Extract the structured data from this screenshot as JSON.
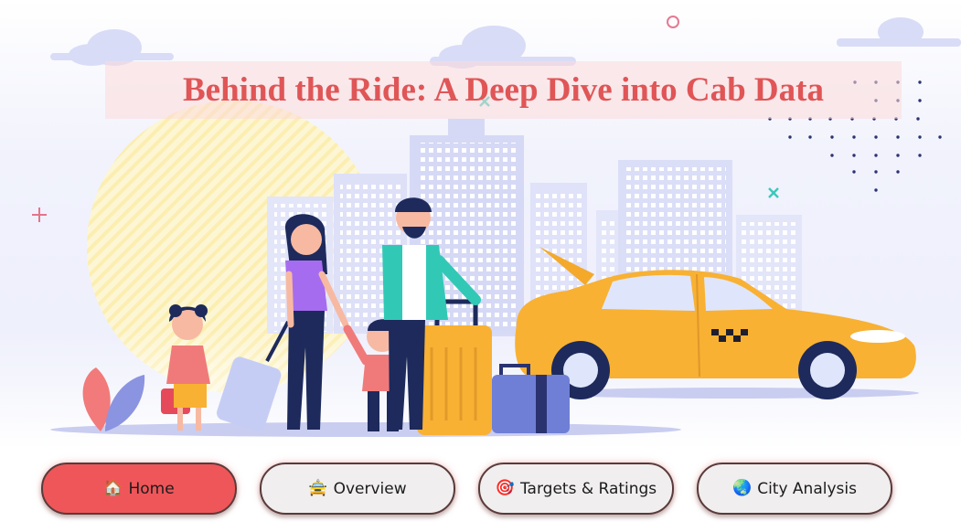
{
  "page": {
    "title": "Behind the Ride: A Deep Dive into Cab Data"
  },
  "nav": {
    "active": "home",
    "buttons": [
      {
        "id": "home",
        "label": "Home",
        "icon": "house-icon",
        "glyph": "🏠"
      },
      {
        "id": "overview",
        "label": "Overview",
        "icon": "taxi-icon",
        "glyph": "🚖"
      },
      {
        "id": "targets",
        "label": "Targets & Ratings",
        "icon": "target-icon",
        "glyph": "🎯"
      },
      {
        "id": "city",
        "label": "City Analysis",
        "icon": "globe-icon",
        "glyph": "🌏"
      }
    ]
  },
  "colors": {
    "accent": "#ef5659",
    "title": "#e05556",
    "taxi": "#f8b133",
    "sky": "#eef0fb",
    "building": "#dfe2f8"
  }
}
